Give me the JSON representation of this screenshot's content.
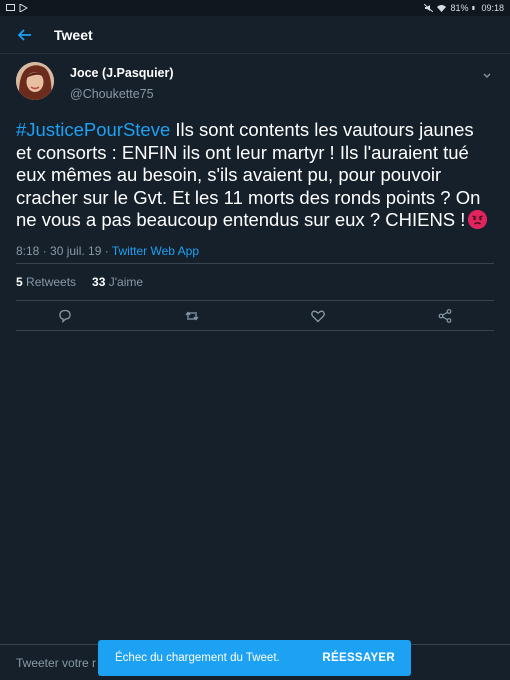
{
  "status_bar": {
    "battery": "81%",
    "time": "09:18"
  },
  "app_bar": {
    "title": "Tweet"
  },
  "tweet": {
    "display_name": "Joce (J.Pasquier)",
    "handle": "@Choukette75",
    "hashtag": "#JusticePourSteve",
    "text": " Ils sont contents les vautours jaunes et consorts : ENFIN ils ont leur martyr ! Ils l'auraient tué eux mêmes au besoin, s'ils avaient pu, pour pouvoir cracher sur le Gvt. Et les 11 morts des ronds points ? On ne vous a pas beaucoup entendus sur eux ? CHIENS !",
    "emoji": "angry-face-emoji",
    "timestamp": "8:18 · 30 juil. 19 · ",
    "client": "Twitter Web App"
  },
  "stats": {
    "retweets_count": "5",
    "retweets_label": " Retweets",
    "likes_count": "33",
    "likes_label": " J'aime"
  },
  "actions": [
    "reply-icon",
    "retweet-icon",
    "like-icon",
    "share-icon"
  ],
  "compose": {
    "placeholder": "Tweeter votre r"
  },
  "snackbar": {
    "message": "Échec du chargement du Tweet.",
    "action": "RÉESSAYER"
  },
  "colors": {
    "background": "#15202b",
    "accent": "#1da1f2",
    "secondary_text": "#8899a6"
  }
}
